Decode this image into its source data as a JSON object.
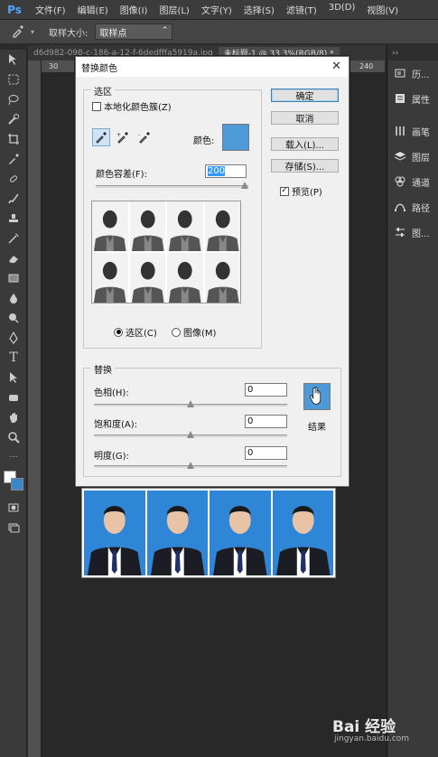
{
  "app": {
    "logo": "Ps"
  },
  "menu": [
    "文件(F)",
    "编辑(E)",
    "图像(I)",
    "图层(L)",
    "文字(Y)",
    "选择(S)",
    "滤镜(T)",
    "3D(D)",
    "视图(V)"
  ],
  "options": {
    "sample_size_label": "取样大小:",
    "sample_size_value": "取样点"
  },
  "tabs": [
    "d6d982-098-c-186-a-12-f-6dedfffa5919a.jpg",
    "未标题-1 @ 33.3%(RGB/8) *"
  ],
  "ruler": {
    "top_start": "30",
    "top_end": "240"
  },
  "right_panels": [
    {
      "icon": "history-icon",
      "label": "历..."
    },
    {
      "icon": "properties-icon",
      "label": "属性"
    },
    {
      "icon": "brush-icon",
      "label": "画笔"
    },
    {
      "icon": "layers-icon",
      "label": "图层"
    },
    {
      "icon": "channels-icon",
      "label": "通道"
    },
    {
      "icon": "paths-icon",
      "label": "路径"
    },
    {
      "icon": "adjust-icon",
      "label": "图..."
    }
  ],
  "dialog": {
    "title": "替换颜色",
    "selection_group": "选区",
    "localized_clusters": "本地化颜色簇(Z)",
    "localized_checked": false,
    "color_label": "颜色:",
    "selection_color": "#4e9ad8",
    "fuzziness_label": "颜色容差(F):",
    "fuzziness_value": "200",
    "fuzziness_fraction": 1.0,
    "radio_selection": "选区(C)",
    "radio_image": "图像(M)",
    "radio_selected": "selection",
    "replace_group": "替换",
    "hue_label": "色相(H):",
    "hue_value": "0",
    "saturation_label": "饱和度(A):",
    "saturation_value": "0",
    "lightness_label": "明度(G):",
    "lightness_value": "0",
    "result_label": "结果",
    "result_color": "#4e9ad8",
    "buttons": {
      "ok": "确定",
      "cancel": "取消",
      "load": "载入(L)...",
      "save": "存储(S)..."
    },
    "preview_label": "预览(P)",
    "preview_checked": true
  },
  "watermark": {
    "brand": "Bai 经验",
    "url": "jingyan.baidu.com"
  }
}
